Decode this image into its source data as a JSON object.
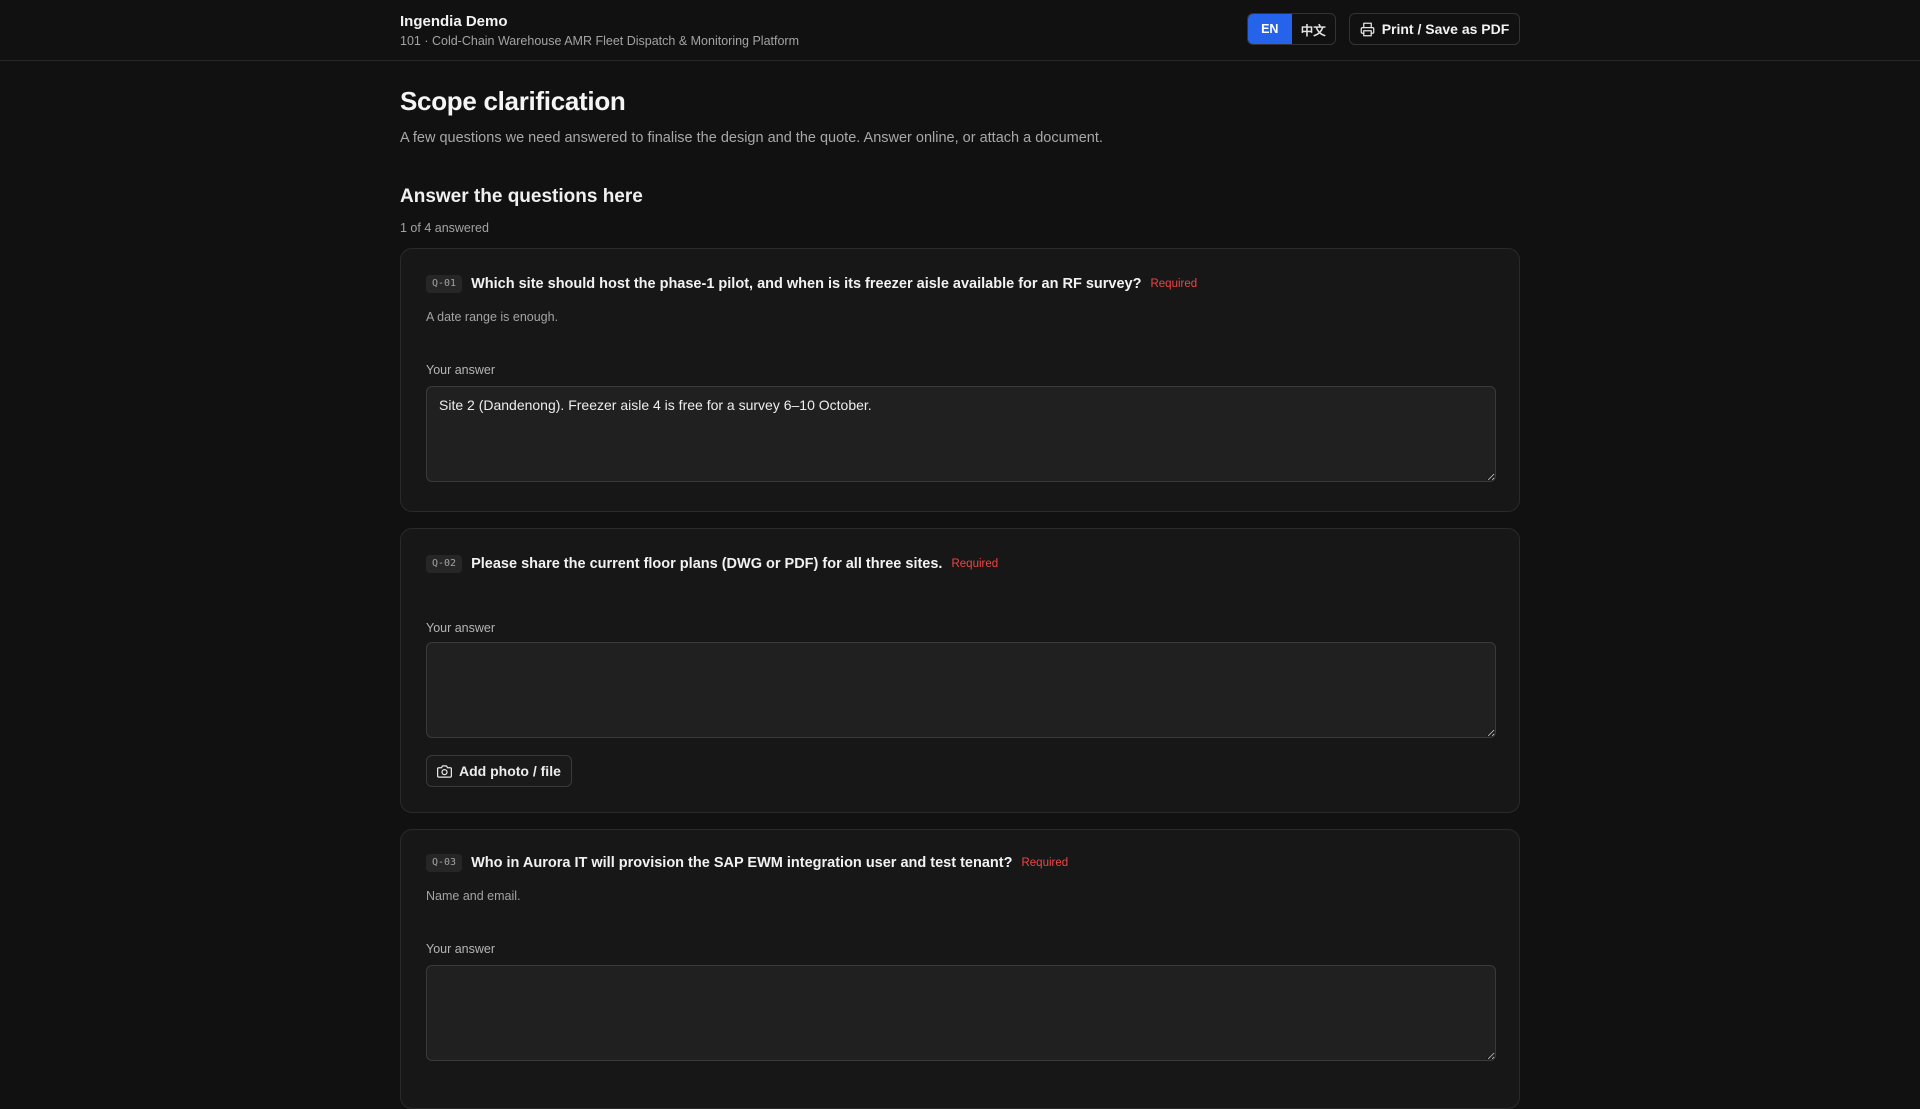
{
  "header": {
    "brand_name": "Ingendia Demo",
    "project_line": "101 · Cold-Chain Warehouse AMR Fleet Dispatch & Monitoring Platform",
    "languages": [
      {
        "code": "EN",
        "active": true
      },
      {
        "code": "中文",
        "active": false
      }
    ],
    "print_label": "Print / Save as PDF",
    "print_icon": "printer-icon"
  },
  "page": {
    "title": "Scope clarification",
    "description": "A few questions we need answered to finalise the design and the quote. Answer online, or attach a document.",
    "section_title": "Answer the questions here",
    "progress": "1 of 4 answered"
  },
  "questions": [
    {
      "id": "Q-01",
      "text": "Which site should host the phase-1 pilot, and when is its freezer aisle available for an RF survey?",
      "required_label": "Required",
      "hint": "A date range is enough.",
      "answer_label": "Your answer",
      "answer": "Site 2 (Dandenong). Freezer aisle 4 is free for a survey 6–10 October."
    },
    {
      "id": "Q-02",
      "text": "Please share the current floor plans (DWG or PDF) for all three sites.",
      "required_label": "Required",
      "hint": "",
      "answer_label": "Your answer",
      "answer": "",
      "file_button_label": "Add photo / file",
      "file_button_icon": "camera-icon"
    },
    {
      "id": "Q-03",
      "text": "Who in Aurora IT will provision the SAP EWM integration user and test tenant?",
      "required_label": "Required",
      "hint": "Name and email.",
      "answer_label": "Your answer",
      "answer": ""
    }
  ],
  "colors": {
    "background": "#111111",
    "card": "#171717",
    "accent": "#2563eb",
    "required": "#ef4444"
  }
}
